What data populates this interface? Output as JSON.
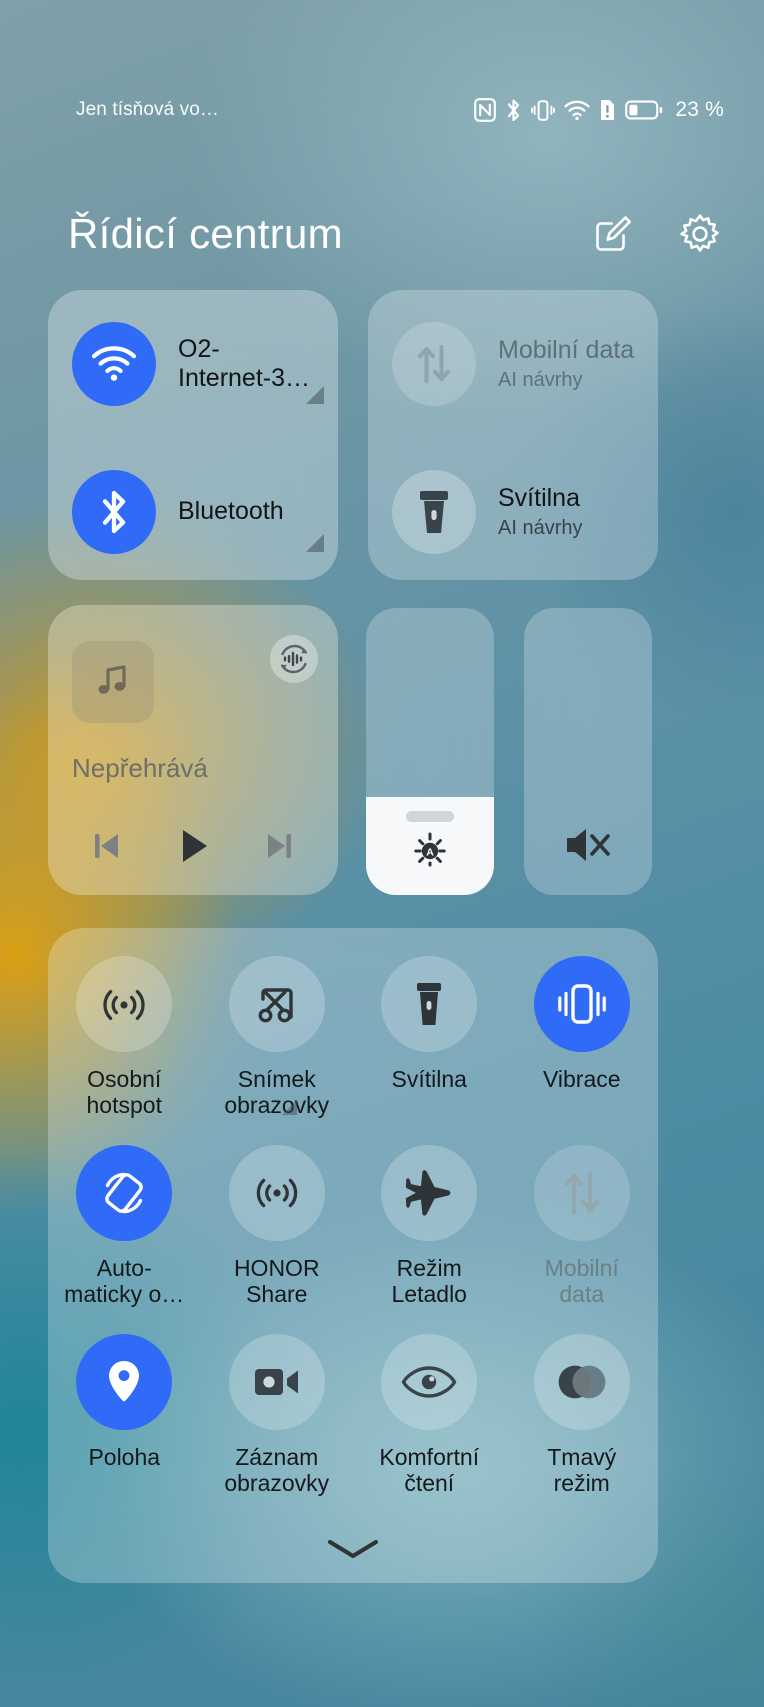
{
  "statusbar": {
    "carrier": "Jen tísňová vo…",
    "battery_text": "23 %",
    "icons": [
      "nfc-icon",
      "bluetooth-icon",
      "vibrate-icon",
      "wifi-icon",
      "sim-alert-icon",
      "battery-icon"
    ]
  },
  "header": {
    "title": "Řídicí centrum",
    "edit_icon": "edit-square-icon",
    "settings_icon": "gear-icon"
  },
  "connectivity": {
    "wifi": {
      "label": "O2-\nInternet-3…",
      "icon": "wifi-icon",
      "state": "on"
    },
    "bluetooth": {
      "label": "Bluetooth",
      "icon": "bluetooth-icon",
      "state": "on"
    },
    "mobile_data": {
      "label": "Mobilní data",
      "sub": "AI návrhy",
      "icon": "mobile-data-icon",
      "state": "off-disabled"
    },
    "flashlight": {
      "label": "Svítilna",
      "sub": "AI návrhy",
      "icon": "flashlight-icon",
      "state": "off"
    }
  },
  "media": {
    "title": "Nepřehrává",
    "art_icon": "music-note-icon",
    "cast_icon": "audio-cast-icon",
    "prev_icon": "skip-previous-icon",
    "play_icon": "play-icon",
    "next_icon": "skip-next-icon"
  },
  "brightness": {
    "icon": "auto-brightness-icon",
    "level_percent": 34,
    "auto": true
  },
  "mute": {
    "icon": "volume-mute-icon",
    "state": "off"
  },
  "toggles": [
    {
      "label": "Osobní\nhotspot",
      "icon": "hotspot-icon",
      "state": "off",
      "expandable": false
    },
    {
      "label": "Snímek\nobrazovky",
      "icon": "screenshot-scissors-icon",
      "state": "off",
      "expandable": true
    },
    {
      "label": "Svítilna",
      "icon": "flashlight-icon",
      "state": "off",
      "expandable": false
    },
    {
      "label": "Vibrace",
      "icon": "vibrate-icon",
      "state": "on",
      "expandable": false
    },
    {
      "label": "Auto-\nmaticky o…",
      "icon": "auto-rotate-icon",
      "state": "on",
      "expandable": false
    },
    {
      "label": "HONOR\nShare",
      "icon": "honor-share-icon",
      "state": "off",
      "expandable": false
    },
    {
      "label": "Režim\nLetadlo",
      "icon": "airplane-icon",
      "state": "off",
      "expandable": false
    },
    {
      "label": "Mobilní\ndata",
      "icon": "mobile-data-icon",
      "state": "off-disabled",
      "expandable": false
    },
    {
      "label": "Poloha",
      "icon": "location-pin-icon",
      "state": "on",
      "expandable": false
    },
    {
      "label": "Záznam\nobrazovky",
      "icon": "screen-record-icon",
      "state": "off",
      "expandable": false
    },
    {
      "label": "Komfortní\nčtení",
      "icon": "eye-comfort-icon",
      "state": "off",
      "expandable": false
    },
    {
      "label": "Tmavý\nrežim",
      "icon": "dark-mode-icon",
      "state": "off",
      "expandable": false
    }
  ],
  "footer": {
    "collapse_icon": "chevron-down-icon"
  },
  "colors": {
    "accent": "#2f6bf6",
    "text": "#15191c",
    "text_dim": "#6c7f86"
  }
}
